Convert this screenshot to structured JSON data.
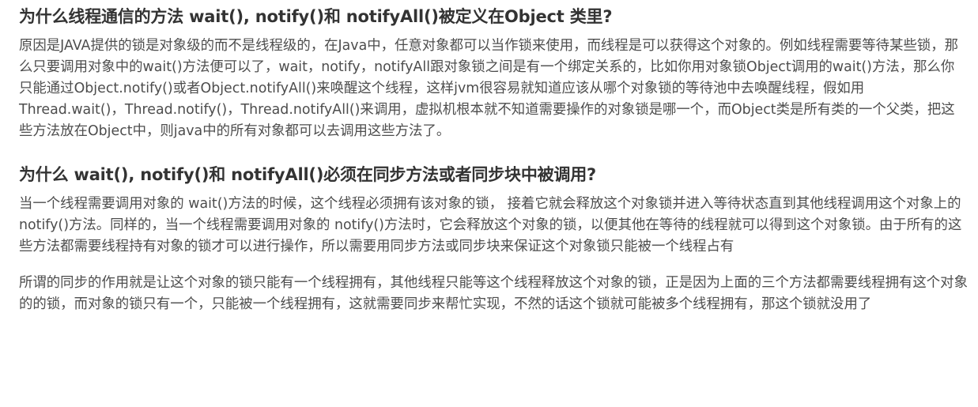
{
  "sections": [
    {
      "title": "为什么线程通信的方法 wait(), notify()和 notifyAll()被定义在Object 类里?",
      "paragraphs": [
        "原因是JAVA提供的锁是对象级的而不是线程级的，在Java中，任意对象都可以当作锁来使用，而线程是可以获得这个对象的。例如线程需要等待某些锁，那么只要调用对象中的wait()方法便可以了，wait，notify，notifyAll跟对象锁之间是有一个绑定关系的，比如你用对象锁Object调用的wait()方法，那么你只能通过Object.notify()或者Object.notifyAll()来唤醒这个线程，这样jvm很容易就知道应该从哪个对象锁的等待池中去唤醒线程，假如用Thread.wait()，Thread.notify()，Thread.notifyAll()来调用，虚拟机根本就不知道需要操作的对象锁是哪一个，而Object类是所有类的一个父类，把这些方法放在Object中，则java中的所有对象都可以去调用这些方法了。"
      ]
    },
    {
      "title": "为什么 wait(), notify()和 notifyAll()必须在同步方法或者同步块中被调用?",
      "paragraphs": [
        "当一个线程需要调用对象的 wait()方法的时候，这个线程必须拥有该对象的锁， 接着它就会释放这个对象锁并进入等待状态直到其他线程调用这个对象上的notify()方法。同样的，当一个线程需要调用对象的 notify()方法时，它会释放这个对象的锁，以便其他在等待的线程就可以得到这个对象锁。由于所有的这些方法都需要线程持有对象的锁才可以进行操作，所以需要用同步方法或同步块来保证这个对象锁只能被一个线程占有",
        "所谓的同步的作用就是让这个对象的锁只能有一个线程拥有，其他线程只能等这个线程释放这个对象的锁，正是因为上面的三个方法都需要线程拥有这个对象的的锁，而对象的锁只有一个，只能被一个线程拥有，这就需要同步来帮忙实现，不然的话这个锁就可能被多个线程拥有，那这个锁就没用了"
      ]
    }
  ],
  "colors": {
    "heading": "#333333",
    "body_text": "#4d4d4d",
    "background": "#ffffff"
  }
}
